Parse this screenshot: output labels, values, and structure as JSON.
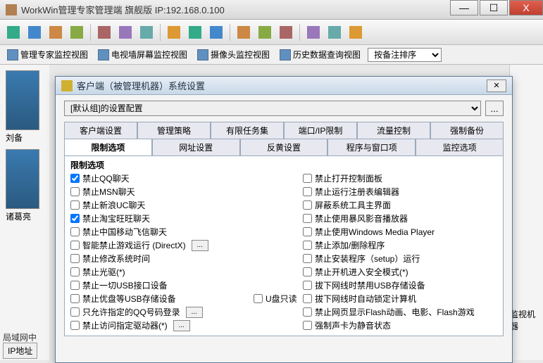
{
  "titlebar": {
    "title": "WorkWin管理专家管理端   旗舰版 IP:192.168.0.100"
  },
  "wincontrols": {
    "min": "—",
    "max": "☐",
    "close": "X"
  },
  "viewbar": {
    "v1": "管理专家监控视图",
    "v2": "电视墙屏幕监控视图",
    "v3": "摄像头监控视图",
    "v4": "历史数据查询视图",
    "sort": "按备注排序"
  },
  "thumbs": {
    "t1": "刘备",
    "t2": "诸葛亮"
  },
  "bottom": {
    "tab1": "局域网中",
    "ip": "IP地址",
    "right": "监视机器"
  },
  "dialog": {
    "title": "客户端（被管理机器）系统设置",
    "config_select": "[默认组]的设置配置",
    "more": "...",
    "close": "✕",
    "tabs1": [
      "客户端设置",
      "管理策略",
      "有限任务集",
      "端口/IP限制",
      "流量控制",
      "强制备份"
    ],
    "tabs2": [
      "限制选项",
      "网址设置",
      "反黄设置",
      "程序与窗口项",
      "监控选项"
    ],
    "group_title": "限制选项",
    "left_opts": [
      {
        "label": "禁止QQ聊天",
        "checked": true,
        "btn": false
      },
      {
        "label": "禁止MSN聊天",
        "checked": false,
        "btn": false
      },
      {
        "label": "禁止新浪UC聊天",
        "checked": false,
        "btn": false
      },
      {
        "label": "禁止淘宝旺旺聊天",
        "checked": true,
        "btn": false
      },
      {
        "label": "禁止中国移动飞信聊天",
        "checked": false,
        "btn": false
      },
      {
        "label": "智能禁止游戏运行 (DirectX)",
        "checked": false,
        "btn": true
      },
      {
        "label": "禁止修改系统时间",
        "checked": false,
        "btn": false
      },
      {
        "label": "禁止光驱(*)",
        "checked": false,
        "btn": false
      },
      {
        "label": "禁止一切USB接口设备",
        "checked": false,
        "btn": false
      },
      {
        "label": "禁止优盘等USB存储设备",
        "checked": false,
        "btn": false,
        "mid": "U盘只读"
      },
      {
        "label": "只允许指定的QQ号码登录",
        "checked": false,
        "btn": true
      },
      {
        "label": "禁止访问指定驱动器(*)",
        "checked": false,
        "btn": true
      }
    ],
    "right_opts": [
      {
        "label": "禁止打开控制面板",
        "checked": false
      },
      {
        "label": "禁止运行注册表编辑器",
        "checked": false
      },
      {
        "label": "屏蔽系统工具主界面",
        "checked": false
      },
      {
        "label": "禁止使用暴风影音播放器",
        "checked": false
      },
      {
        "label": "禁止使用Windows Media Player",
        "checked": false
      },
      {
        "label": "禁止添加/删除程序",
        "checked": false
      },
      {
        "label": "禁止安装程序（setup）运行",
        "checked": false
      },
      {
        "label": "禁止开机进入安全模式(*)",
        "checked": false
      },
      {
        "label": "拔下网线时禁用USB存储设备",
        "checked": false
      },
      {
        "label": "拔下网线时自动锁定计算机",
        "checked": false
      },
      {
        "label": "禁止网页显示Flash动画、电影、Flash游戏",
        "checked": false
      },
      {
        "label": "强制声卡为静音状态",
        "checked": false
      }
    ]
  }
}
